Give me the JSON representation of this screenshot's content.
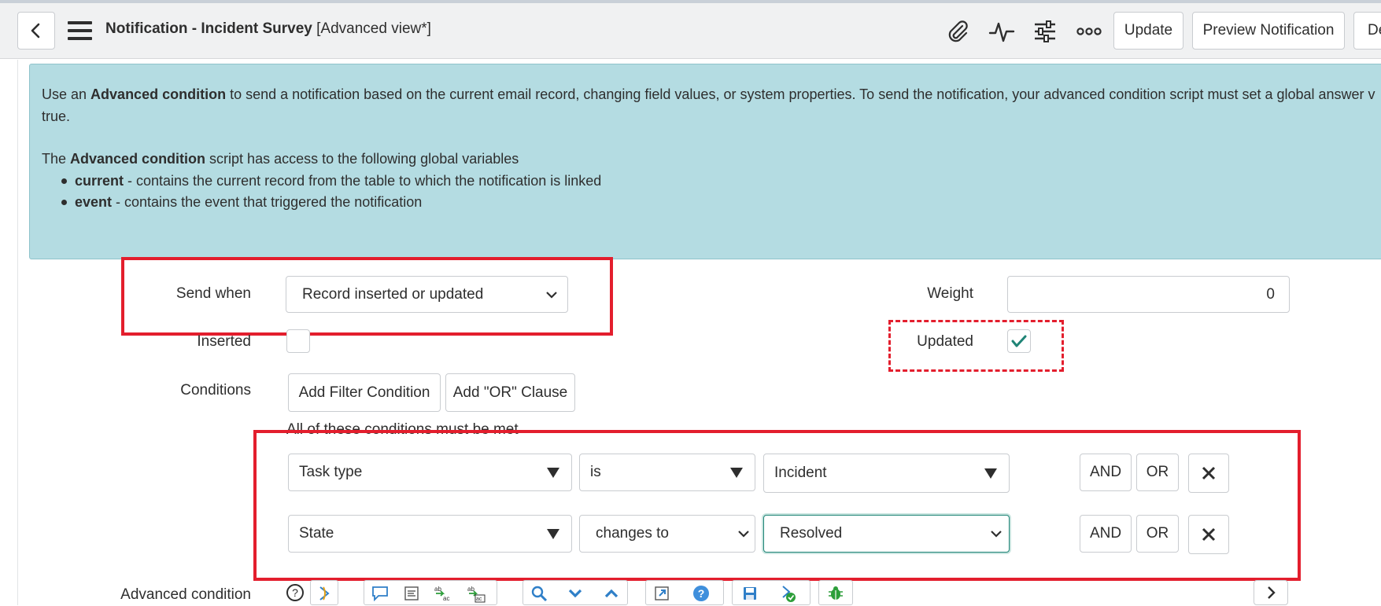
{
  "header": {
    "title_main": "Notification - Incident Survey",
    "title_suffix": " [Advanced view*]",
    "update_label": "Update",
    "preview_label": "Preview Notification",
    "delete_label_partial": "De",
    "icons": [
      "back-icon",
      "hamburger-menu-icon",
      "attachment-icon",
      "activity-icon",
      "settings-sliders-icon",
      "more-options-icon"
    ]
  },
  "info": {
    "line1_pre": "Use an ",
    "line1_bold": "Advanced condition",
    "line1_post": " to send a notification based on the current email record, changing field values, or system properties. To send the notification, your advanced condition script must set a global answer v",
    "line2": "true.",
    "line3_pre": "The ",
    "line3_bold": "Advanced condition",
    "line3_post": " script has access to the following global variables",
    "vars": [
      {
        "name": "current",
        "desc": " - contains the current record from the table to which the notification is linked"
      },
      {
        "name": "event",
        "desc": " - contains the event that triggered the notification"
      }
    ]
  },
  "form": {
    "send_when_label": "Send when",
    "send_when_value": "Record inserted or updated",
    "weight_label": "Weight",
    "weight_value": "0",
    "inserted_label": "Inserted",
    "inserted_checked": false,
    "updated_label": "Updated",
    "updated_checked": true,
    "conditions_label": "Conditions",
    "add_filter_label": "Add Filter Condition",
    "add_or_label": "Add \"OR\" Clause",
    "conditions_note": "All of these conditions must be met",
    "rows": [
      {
        "field": "Task type",
        "operator": "is",
        "value": "Incident",
        "and": "AND",
        "or": "OR"
      },
      {
        "field": "State",
        "operator": "changes to",
        "value": "Resolved",
        "and": "AND",
        "or": "OR"
      }
    ],
    "advanced_condition_label": "Advanced condition"
  },
  "colors": {
    "highlight_red": "#e31e2d",
    "info_bg": "#b4dce2",
    "check_green": "#1f8476"
  }
}
